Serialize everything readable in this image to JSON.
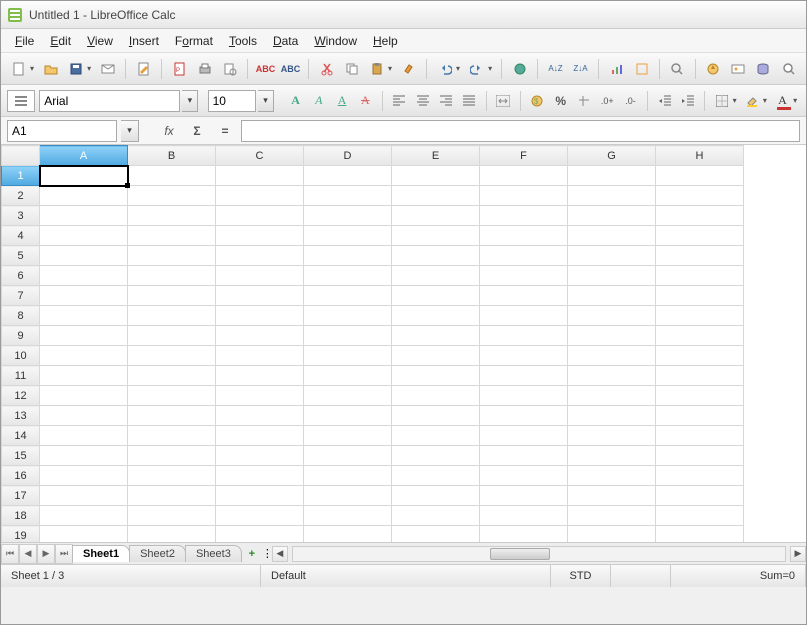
{
  "window": {
    "title": "Untitled 1 - LibreOffice Calc"
  },
  "menu": {
    "items": [
      "File",
      "Edit",
      "View",
      "Insert",
      "Format",
      "Tools",
      "Data",
      "Window",
      "Help"
    ]
  },
  "toolbar_format": {
    "font_name": "Arial",
    "font_size": "10"
  },
  "formula_bar": {
    "cell_ref": "A1",
    "fx_label": "fx",
    "sigma_label": "Σ",
    "equals_label": "=",
    "formula_value": ""
  },
  "grid": {
    "columns": [
      "A",
      "B",
      "C",
      "D",
      "E",
      "F",
      "G",
      "H"
    ],
    "row_count": 19,
    "active_col": "A",
    "active_row": 1
  },
  "sheet_tabs": {
    "tabs": [
      "Sheet1",
      "Sheet2",
      "Sheet3"
    ],
    "active": "Sheet1",
    "add_label": "+"
  },
  "status": {
    "sheet_info": "Sheet 1 / 3",
    "style": "Default",
    "mode": "STD",
    "sum": "Sum=0"
  },
  "icons": {
    "app": "calc-icon"
  }
}
